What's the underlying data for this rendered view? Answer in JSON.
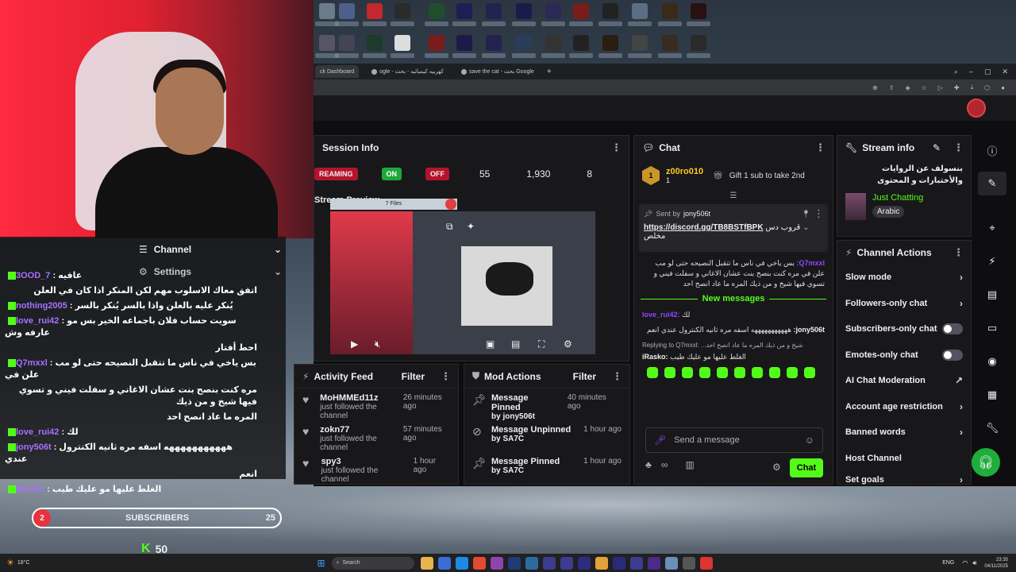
{
  "browser": {
    "tabs": [
      "ck Dashboard",
      "ogle - كهربيه كيميائيه - بحث",
      "save the cat - بحث Google"
    ]
  },
  "stream_info": {
    "title": "Session Info",
    "streaming_label": "REAMING",
    "on_label": "ON",
    "off_label": "OFF",
    "stat1": "55",
    "stat2": "1,930",
    "stat3": "8",
    "preview_title": "Stream Preview",
    "preview_files": "7 Files"
  },
  "activity_feed": {
    "title": "Activity Feed",
    "filter": "Filter",
    "items": [
      {
        "name": "MoHMMEd11z",
        "sub": "just followed the channel",
        "time": "26 minutes ago"
      },
      {
        "name": "zokn77",
        "sub": "just followed the channel",
        "time": "57 minutes ago"
      },
      {
        "name": "spy3",
        "sub": "just followed the channel",
        "time": "1 hour ago"
      }
    ]
  },
  "mod_actions": {
    "title": "Mod Actions",
    "filter": "Filter",
    "items": [
      {
        "name": "Message Pinned",
        "by": "by jony506t",
        "time": "40 minutes ago"
      },
      {
        "name": "Message Unpinned",
        "by": "by SA7C",
        "time": "1 hour ago"
      },
      {
        "name": "Message Pinned",
        "by": "by SA7C",
        "time": "1 hour ago"
      }
    ]
  },
  "chat": {
    "title": "Chat",
    "gifter": "z00ro010",
    "gifter_count": "1",
    "gift_text": "Gift 1 sub to take 2nd",
    "pinned_by": "Sent by",
    "pinned_user": "jony506t",
    "pinned_link": "https://discord.gg/TB8BSTfBPK",
    "pinned_tail": "قروب دس",
    "pinned_tail2": "مخلص",
    "msg1_user": "Q7mxxl:",
    "msg1_text": "بس ياخي في ناس ما تتقبل النصيحه حتى لو مب علن في مره كنت بنصح بنت عشان الاغاني و سفلت فيني و تسوي فيها شيخ و من ذيك المره ما عاد انصح احد",
    "new_messages": "New messages",
    "msg2_user": "love_rui42:",
    "msg2_text": "لك",
    "msg3_user": "jony506t:",
    "msg3_text": "هههههههههههه اسفه مره ثانيه الكنترول عندي انعم",
    "reply_to": "Replying to Q7mxxl: ...شيخ و من ذيك المره ما عاد انصح احد",
    "msg4_user": "iRasko:",
    "msg4_text": "الغلط عليها مو عليك طيب",
    "input_placeholder": "Send a message",
    "send_button": "Chat"
  },
  "stream_info_panel": {
    "title": "Stream info",
    "stream_title": "بنسولف عن الروايات والأختبارات و المحتوى",
    "category": "Just Chatting",
    "language": "Arabic"
  },
  "channel_actions": {
    "title": "Channel Actions",
    "rows": [
      {
        "label": "Slow mode",
        "kind": "chevron"
      },
      {
        "label": "Followers-only chat",
        "kind": "chevron"
      },
      {
        "label": "Subscribers-only chat",
        "kind": "toggle"
      },
      {
        "label": "Emotes-only chat",
        "kind": "toggle"
      },
      {
        "label": "AI Chat Moderation",
        "kind": "external"
      },
      {
        "label": "Account age restriction",
        "kind": "chevron"
      },
      {
        "label": "Banned words",
        "kind": "chevron"
      },
      {
        "label": "Host Channel",
        "kind": "none"
      },
      {
        "label": "Set goals",
        "kind": "chevron"
      }
    ]
  },
  "overlay": {
    "menu_channel": "Channel",
    "menu_settings": "Settings",
    "lines": [
      {
        "user": "3OOD_7",
        "text": "عافيه"
      },
      {
        "user": "",
        "text": "اتفق معاك الاسلوب مهم لكن المنكر اذا كان في العلن"
      },
      {
        "user": "nothing2005",
        "text": "يُنكر عليه بالعلن واذا بالسر يُنكر بالسر"
      },
      {
        "user": "love_rui42",
        "text": "سويت حساب فلان باجماعه الخير بس مو عارفه وش"
      },
      {
        "user": "",
        "text": "احط أفتار"
      },
      {
        "user": "Q7mxxl",
        "text": "بس ياخي في ناس ما تتقبل النصيحه حتى لو مب علن في"
      },
      {
        "user": "",
        "text": "مره كنت بنصح بنت عشان الاغاني و سفلت فيني و تسوي فيها شيخ و من ذيك"
      },
      {
        "user": "",
        "text": "المره ما عاد انصح احد"
      },
      {
        "user": "love_rui42",
        "text": "لك"
      },
      {
        "user": "jony506t",
        "text": "هههههههههههه اسفه مره ثانيه الكنترول عندي"
      },
      {
        "user": "",
        "text": "انعم"
      },
      {
        "user": "iRasko",
        "text": "الغلط عليها مو عليك طيب"
      }
    ],
    "sub_count_badge": "2",
    "sub_label": "SUBSCRIBERS",
    "sub_goal": "25",
    "followers": "50"
  },
  "taskbar": {
    "search": "Search",
    "weather": "18°C",
    "lang": "ENG",
    "time": "23:35",
    "date": "04/11/2025"
  },
  "colors": {
    "accent": "#53fc18",
    "brand": "#9147ff",
    "live": "#e8323f"
  }
}
